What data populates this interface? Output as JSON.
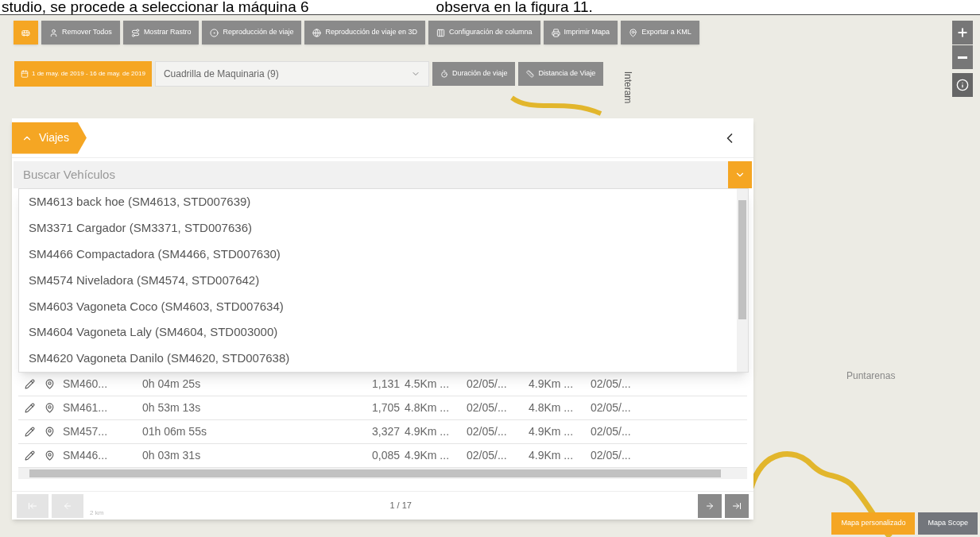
{
  "document_text": [
    "studio, se procede a seleccionar la máquina 6",
    "observa en la figura 11."
  ],
  "toolbar": [
    {
      "selected": true
    },
    {
      "label": "Remover Todos",
      "selected": false
    },
    {
      "label": "Mostrar Rastro",
      "selected": false
    },
    {
      "label": "Reproducción de viaje",
      "selected": false
    },
    {
      "label": "Reproducción de viaje en 3D",
      "selected": false
    },
    {
      "label": "Configuración de columna",
      "selected": false
    },
    {
      "label": "Imprimir Mapa",
      "selected": false
    },
    {
      "label": "Exportar a KML",
      "selected": false
    }
  ],
  "filters": {
    "date_range": "1 de may. de 2019 - 16 de may. de 2019",
    "group_select": "Cuadrilla de Maquinaria (9)",
    "buttons": [
      "Duración de viaje",
      "Distancia de Viaje"
    ]
  },
  "map_labels": [
    "Interam",
    "Puntarenas"
  ],
  "panel": {
    "tab": "Viajes",
    "search": {
      "placeholder": "Buscar Vehículos"
    },
    "dropdown": [
      "SM4613 back hoe (SM4613, STD007639)",
      "SM3371 Cargador (SM3371, STD007636)",
      "SM4466 Compactadora (SM4466, STD007630)",
      "SM4574 Niveladora (SM4574, STD007642)",
      "SM4603 Vagoneta Coco (SM4603, STD007634)",
      "SM4604 Vagoneta Laly (SM4604, STD003000)",
      "SM4620 Vagoneta Danilo (SM4620, STD007638)"
    ],
    "rows": [
      [
        "SM460...",
        "0h 04m 25s",
        "1,131",
        "4.5Km ...",
        "02/05/...",
        "4.9Km ...",
        "02/05/..."
      ],
      [
        "SM461...",
        "0h 53m 13s",
        "1,705",
        "4.8Km ...",
        "02/05/...",
        "4.8Km ...",
        "02/05/..."
      ],
      [
        "SM457...",
        "01h 06m 55s",
        "3,327",
        "4.9Km ...",
        "02/05/...",
        "4.9Km ...",
        "02/05/..."
      ],
      [
        "SM446...",
        "0h 03m 31s",
        "0,085",
        "4.9Km ...",
        "02/05/...",
        "4.9Km ...",
        "02/05/..."
      ]
    ],
    "pagination": "1 / 17",
    "scale": "2 km"
  },
  "map_types": [
    {
      "label": "Mapa personalizado",
      "selected": true
    },
    {
      "label": "Mapa Scope",
      "selected": false
    }
  ]
}
